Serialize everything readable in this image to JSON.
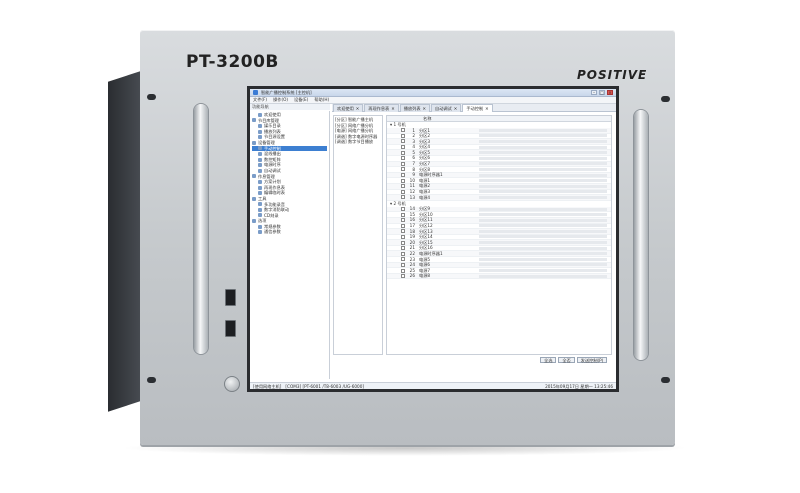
{
  "device": {
    "model": "PT-3200B",
    "brand": "POSITIVE"
  },
  "app": {
    "title": "智能广播控制系统 [主控机]",
    "menu": [
      "文件(F)",
      "操作(O)",
      "设备(E)",
      "帮助(H)"
    ],
    "nav_header": "功能导航",
    "tree": [
      {
        "label": "欢迎使用",
        "level": 1
      },
      {
        "label": "节目库管理",
        "level": 0
      },
      {
        "label": "媒乐目录",
        "level": 1
      },
      {
        "label": "播放列表",
        "level": 1
      },
      {
        "label": "节目源设置",
        "level": 1
      },
      {
        "label": "设备管理",
        "level": 0
      },
      {
        "label": "手动控制",
        "level": 1,
        "selected": true
      },
      {
        "label": "混线播出",
        "level": 1
      },
      {
        "label": "数控矩阵",
        "level": 1
      },
      {
        "label": "电源时序",
        "level": 1
      },
      {
        "label": "自动调试",
        "level": 1
      },
      {
        "label": "作息管理",
        "level": 0
      },
      {
        "label": "方案计划",
        "level": 1
      },
      {
        "label": "再现作息表",
        "level": 1
      },
      {
        "label": "编辑临时表",
        "level": 1
      },
      {
        "label": "工具",
        "level": 0
      },
      {
        "label": "多功能录音",
        "level": 1
      },
      {
        "label": "数字消防联动",
        "level": 1
      },
      {
        "label": "CD刻录",
        "level": 1
      },
      {
        "label": "选项",
        "level": 0
      },
      {
        "label": "常规参数",
        "level": 1
      },
      {
        "label": "通信参数",
        "level": 1
      }
    ],
    "tabs": [
      {
        "label": "欢迎使用",
        "active": false
      },
      {
        "label": "再现作息表",
        "active": false
      },
      {
        "label": "播放列表",
        "active": false
      },
      {
        "label": "自动调试",
        "active": false
      },
      {
        "label": "手动控制",
        "active": true
      }
    ],
    "device_list": [
      "[分区] 智能广播主机",
      "[分区] 网络广播分机",
      "[电源] 网络广播分机",
      "[调谐] 数字电源时序器",
      "[调谐] 数字节目播放"
    ],
    "grid_header": "名称",
    "groups": [
      {
        "label": "1 号机",
        "rows": [
          {
            "num": "1",
            "name": "分区1"
          },
          {
            "num": "2",
            "name": "分区2"
          },
          {
            "num": "3",
            "name": "分区3"
          },
          {
            "num": "4",
            "name": "分区4"
          },
          {
            "num": "5",
            "name": "分区5"
          },
          {
            "num": "6",
            "name": "分区6"
          },
          {
            "num": "7",
            "name": "分区7"
          },
          {
            "num": "8",
            "name": "分区8"
          },
          {
            "num": "9",
            "name": "电源时序器1"
          },
          {
            "num": "10",
            "name": "电源1"
          },
          {
            "num": "11",
            "name": "电源2"
          },
          {
            "num": "12",
            "name": "电源3"
          },
          {
            "num": "13",
            "name": "电源4"
          }
        ]
      },
      {
        "label": "2 号机",
        "rows": [
          {
            "num": "14",
            "name": "分区9"
          },
          {
            "num": "15",
            "name": "分区10"
          },
          {
            "num": "16",
            "name": "分区11"
          },
          {
            "num": "17",
            "name": "分区12"
          },
          {
            "num": "18",
            "name": "分区13"
          },
          {
            "num": "19",
            "name": "分区14"
          },
          {
            "num": "20",
            "name": "分区15"
          },
          {
            "num": "21",
            "name": "分区16"
          },
          {
            "num": "22",
            "name": "电源时序器1"
          },
          {
            "num": "23",
            "name": "电源5"
          },
          {
            "num": "24",
            "name": "电源6"
          },
          {
            "num": "25",
            "name": "电源7"
          },
          {
            "num": "26",
            "name": "电源8"
          }
        ]
      }
    ],
    "buttons": [
      "全选",
      "全否",
      "发送控制(P)"
    ],
    "status_left": "[使用网络主机]",
    "status_mid": "[COM3] [PT-6001 /T8-6003 /UG-6000]",
    "status_right": "2015年09月17日 星期一 13:25:46"
  }
}
